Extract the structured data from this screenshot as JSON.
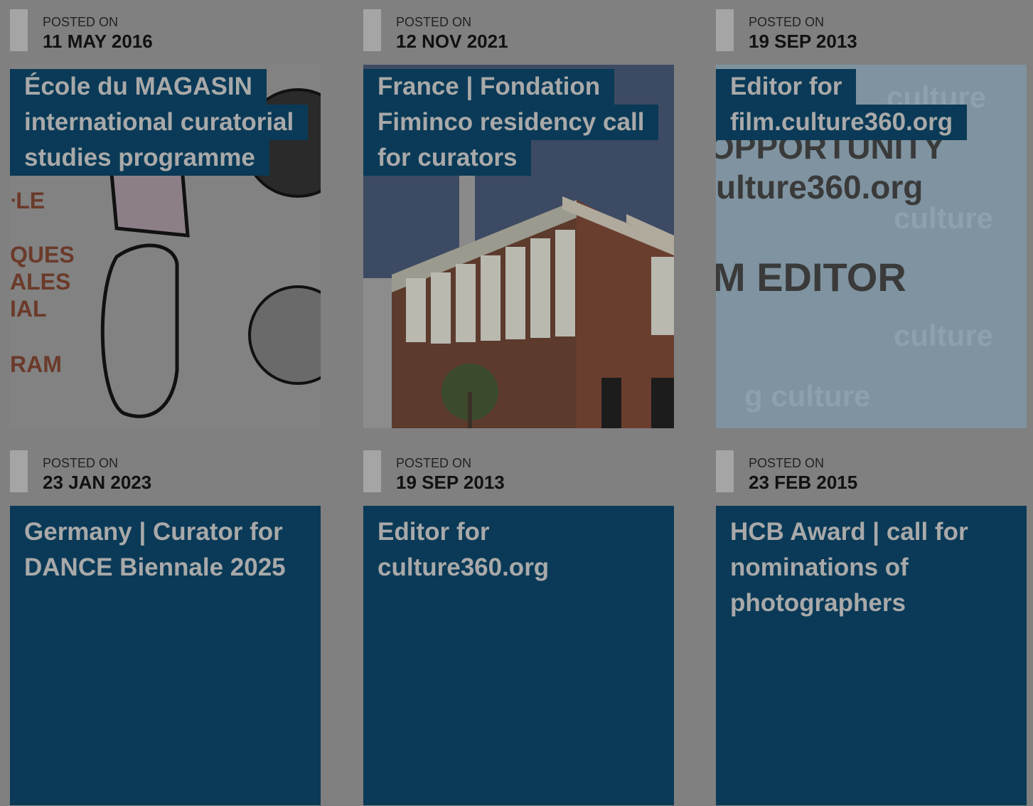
{
  "posts": [
    {
      "posted_label": "POSTED ON",
      "date": "11 MAY 2016",
      "title_lines": [
        "École du MAGASIN",
        "international curatorial",
        "studies programme"
      ],
      "image": "poster-image",
      "poster_texts": [
        "LE",
        "QUES",
        "ALES",
        "IAL",
        "RAM"
      ]
    },
    {
      "posted_label": "POSTED ON",
      "date": "12 NOV 2021",
      "title_lines": [
        "France | Fondation",
        "Fiminco residency call",
        "for curators"
      ],
      "image": "building-photo"
    },
    {
      "posted_label": "POSTED ON",
      "date": "19 SEP 2013",
      "title_lines": [
        "Editor for",
        "film.culture360.org"
      ],
      "image": "culture360-banner",
      "banner_texts": [
        "OPPORTUNITY",
        "ulture360.org",
        "M EDITOR"
      ]
    },
    {
      "posted_label": "POSTED ON",
      "date": "23 JAN 2023",
      "title_lines": [
        "Germany | Curator for",
        "DANCE Biennale 2025"
      ],
      "image": "none"
    },
    {
      "posted_label": "POSTED ON",
      "date": "19 SEP 2013",
      "title_lines": [
        "Editor for",
        "culture360.org"
      ],
      "image": "none"
    },
    {
      "posted_label": "POSTED ON",
      "date": "23 FEB 2015",
      "title_lines": [
        "HCB Award | call for",
        "nominations of",
        "photographers"
      ],
      "image": "none"
    }
  ],
  "colors": {
    "overlay_background": "#808080",
    "title_block": "#0a3a57",
    "date_bar": "#a5a5a5"
  }
}
